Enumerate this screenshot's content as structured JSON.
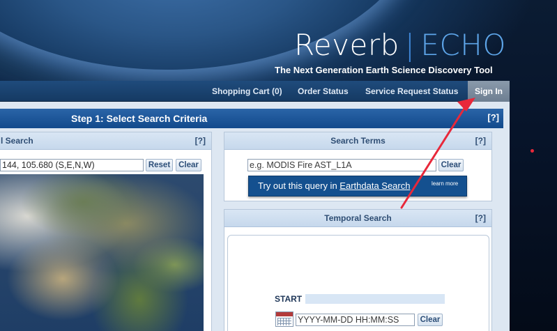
{
  "header": {
    "brand_left": "Reverb",
    "brand_sep": "|",
    "brand_right": "ECHO",
    "tagline": "The Next Generation Earth Science Discovery Tool"
  },
  "nav": {
    "items": [
      {
        "label": "Shopping Cart (0)"
      },
      {
        "label": "Order Status"
      },
      {
        "label": "Service Request Status"
      }
    ],
    "signin": "Sign In"
  },
  "step": {
    "title": "Step 1: Select Search Criteria",
    "help": "[?]"
  },
  "spatial": {
    "title": "l Search",
    "help": "[?]",
    "coords_value": "144, 105.680 (S,E,N,W)",
    "reset_label": "Reset",
    "clear_label": "Clear"
  },
  "search_terms": {
    "title": "Search Terms",
    "help": "[?]",
    "placeholder": "e.g. MODIS Fire AST_L1A",
    "clear_label": "Clear"
  },
  "tooltip": {
    "prefix": "Try out this query in ",
    "link": "Earthdata Search",
    "more": "learn more"
  },
  "temporal": {
    "title": "Temporal Search",
    "help": "[?]",
    "start_label": "START",
    "date_placeholder": "YYYY-MM-DD HH:MM:SS",
    "clear_label": "Clear"
  },
  "colors": {
    "annotation_arrow": "#e8283a",
    "nav_bar": "#1f4b7c",
    "step_bar": "#124a8c"
  }
}
